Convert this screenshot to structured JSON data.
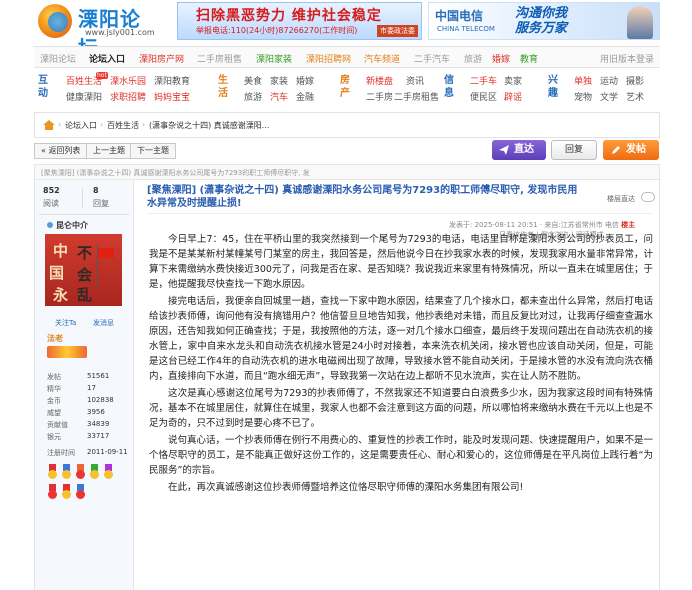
{
  "header": {
    "logo_name": "溧阳论坛",
    "logo_url": "www.jsly001.com",
    "banner1_title": "扫除黑恶势力 维护社会稳定",
    "banner1_sub": "举报电话:110(24小时)87266270(工作时间)",
    "banner1_tag": "市委政法委",
    "banner2_brand": "中国电信",
    "banner2_brand_sub": "CHINA TELECOM",
    "banner2_slogan_1": "沟通你我",
    "banner2_slogan_2": "服务万家"
  },
  "topnav": {
    "left": [
      "溧阳论坛",
      "论坛入口",
      "溧阳房产网",
      "二手房租售",
      "溧阳家装",
      "溧阳招聘网",
      "汽车频道",
      "二手汽车",
      "旅游",
      "婚嫁",
      "教育"
    ],
    "right": "用旧版本登录"
  },
  "categories": {
    "g1": {
      "title": "互动",
      "links": [
        "百姓生活",
        "溧水乐园",
        "溧阳教育",
        "健康溧阳",
        "求职招聘",
        "妈妈宝宝"
      ]
    },
    "g2": {
      "title": "生活",
      "links": [
        "美食",
        "家装",
        "婚嫁",
        "旅游",
        "汽车",
        "金融"
      ]
    },
    "g3": {
      "title": "房产",
      "links": [
        "新楼盘",
        "资讯",
        "二手房",
        "二手房租售"
      ]
    },
    "g4": {
      "title": "信息",
      "links": [
        "二手车",
        "卖家",
        "便民区",
        "辟谣"
      ]
    },
    "g5": {
      "title": "兴趣",
      "links": [
        "单独",
        "运动",
        "摄影",
        "宠物",
        "文学",
        "艺术"
      ]
    },
    "hot_label": "hot"
  },
  "breadcrumb": [
    "论坛入口",
    "百姓生活",
    "(潇事杂说之十四) 真诚感谢溧阳..."
  ],
  "toolbar": {
    "back_list": "« 返回列表",
    "prev": "上一主题",
    "next": "下一主题",
    "zhida": "直达",
    "reply": "回复",
    "post": "发帖"
  },
  "subject_line": "[聚焦溧阳] (潇事杂说之十四) 真诚感谢溧阳水务公司尾号为7293的职工师傅尽职守, 发",
  "author": {
    "views": "852",
    "views_label": "阅读",
    "replies": "8",
    "replies_label": "回复",
    "name": "昆仑中介",
    "follow": "关注Ta",
    "message": "发消息",
    "rank": "法老",
    "stats": [
      {
        "label": "发帖",
        "value": "51561"
      },
      {
        "label": "精华",
        "value": "17"
      },
      {
        "label": "金币",
        "value": "102838"
      },
      {
        "label": "威望",
        "value": "3956"
      },
      {
        "label": "贡献值",
        "value": "34839"
      },
      {
        "label": "银元",
        "value": "33717"
      },
      {
        "label": "注册时间",
        "value": "2011-09-11"
      }
    ],
    "avatar_chars": [
      "中",
      "国",
      "不",
      "会",
      "乱",
      "永"
    ]
  },
  "post": {
    "title": "[聚焦溧阳] (潇事杂说之十四) 真诚感谢溧阳水务公司尾号为7293的职工师傅尽职守, 发现市民用水异常及时提醒止损!",
    "floor_label": "楼层直达",
    "meta_prefix": "发表于: 2025-08-11 20:51 · 来自:江苏省常州市 电信",
    "meta_owner": "楼主",
    "submeta": "只看该作者 | 倒序浏览 | 阅读模式",
    "paragraphs": [
      "今日早上7：45，住在平桥山里的我突然接到一个尾号为7293的电话，电话里自称是溧阳水务公司的抄表员工，问我是不是某某新村某幢某号门某室的房主，我回答是，然后他说今日在抄我家水表的时候，发现我家用水量非常异常，计算下来需缴纳水费快接近300元了，问我是否在家、是否知晓？我说我近来家里有特殊情况，所以一直未在城里居住；于是，他提醒我尽快查找一下跑水原因。",
      "接完电话后，我便亲自回城里一趟，查找一下家中跑水原因，结果查了几个接水口，都未查出什么异常，然后打电话给该抄表师傅，询问他有没有搞错用户？他信誓旦旦地告知我，他抄表绝对未错，而且反复比对过，让我再仔细查查漏水原因，还告知我如何正确查找；于是，我按照他的方法，逐一对几个接水口细查，最后终于发现问题出在自动洗衣机的接水管上，家中自来水龙头和自动洗衣机接水管是24小时对接着，本来洗衣机关闭，接水管也应该自动关闭，但是，可能是这台已经工作4年的自动洗衣机的进水电磁阀出现了故障，导致接水管不能自动关闭，于是接水管的水没有流向洗衣桶内，直接排向下水道，而且“跑水细无声”，导致我第一次站在边上都听不见水流声，实在让人防不胜防。",
      "这次是真心感谢这位尾号为7293的抄表师傅了，不然我家还不知道要白白浪费多少水，因为我家这段时间有特殊情况，基本不在城里居住，就算住在城里，我家人也都不会注意到这方面的问题，所以哪怕将来缴纳水费在千元以上也是不足为奇的，只不过到时是要心疼不已了。",
      "说句真心话，一个抄表师傅在例行不用费心的、重复性的抄表工作时，能及时发现问题、快速提醒用户，如果不是一个恪尽职守的员工，是不能真正做好这份工作的，这是需要责任心、耐心和爱心的，这位师傅是在平凡岗位上践行着“为民服务”的宗旨。",
      "在此，再次真诚感谢这位抄表师傅暨培养这位恪尽职守师傅的溧阳水务集团有限公司!"
    ]
  }
}
